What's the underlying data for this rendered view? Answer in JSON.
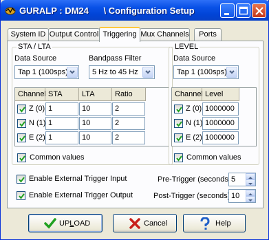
{
  "window": {
    "title": "GURALP : DM24      \\ Configuration Setup",
    "controls": [
      "minimize-icon",
      "maximize-icon",
      "close-icon"
    ]
  },
  "tabs": [
    {
      "label": "System ID"
    },
    {
      "label": "Output Control"
    },
    {
      "label": "Triggering",
      "active": true
    },
    {
      "label": "Mux Channels"
    },
    {
      "label": "Ports"
    }
  ],
  "sta_lta": {
    "group_title": "STA / LTA",
    "data_source_label": "Data Source",
    "data_source_value": "Tap 1 (100sps)",
    "bandpass_label": "Bandpass Filter",
    "bandpass_value": "5 Hz to 45 Hz",
    "columns": [
      "Channel",
      "STA",
      "LTA",
      "Ratio"
    ],
    "rows": [
      {
        "channel": "Z (0)",
        "checked": true,
        "sta": "1",
        "lta": "10",
        "ratio": "2"
      },
      {
        "channel": "N (1)",
        "checked": true,
        "sta": "1",
        "lta": "10",
        "ratio": "2"
      },
      {
        "channel": "E (2)",
        "checked": true,
        "sta": "1",
        "lta": "10",
        "ratio": "2"
      }
    ],
    "common_values_label": "Common values",
    "common_values_checked": true
  },
  "level": {
    "group_title": "LEVEL",
    "data_source_label": "Data Source",
    "data_source_value": "Tap 1 (100sps)",
    "columns": [
      "Channel",
      "Level"
    ],
    "rows": [
      {
        "channel": "Z (0)",
        "checked": true,
        "level": "1000000"
      },
      {
        "channel": "N (1)",
        "checked": true,
        "level": "1000000"
      },
      {
        "channel": "E (2)",
        "checked": true,
        "level": "1000000"
      }
    ],
    "common_values_label": "Common values",
    "common_values_checked": true
  },
  "external": {
    "enable_input_label": "Enable External Trigger Input",
    "enable_input_checked": true,
    "enable_output_label": "Enable External Trigger Output",
    "enable_output_checked": true,
    "pre_trigger_label": "Pre-Trigger (seconds)",
    "pre_trigger_value": "5",
    "post_trigger_label": "Post-Trigger (seconds)",
    "post_trigger_value": "10"
  },
  "buttons": {
    "upload_pre": "UP",
    "upload_underlined": "L",
    "upload_post": "OAD",
    "cancel_label": "Cancel",
    "help_label": "Help"
  },
  "colors": {
    "titlebar": "#0a52e7",
    "active_tab_accent": "#ffc83c",
    "checkmark": "#21a121",
    "cancel_x": "#c8201a",
    "help_icon": "#2060c8"
  }
}
